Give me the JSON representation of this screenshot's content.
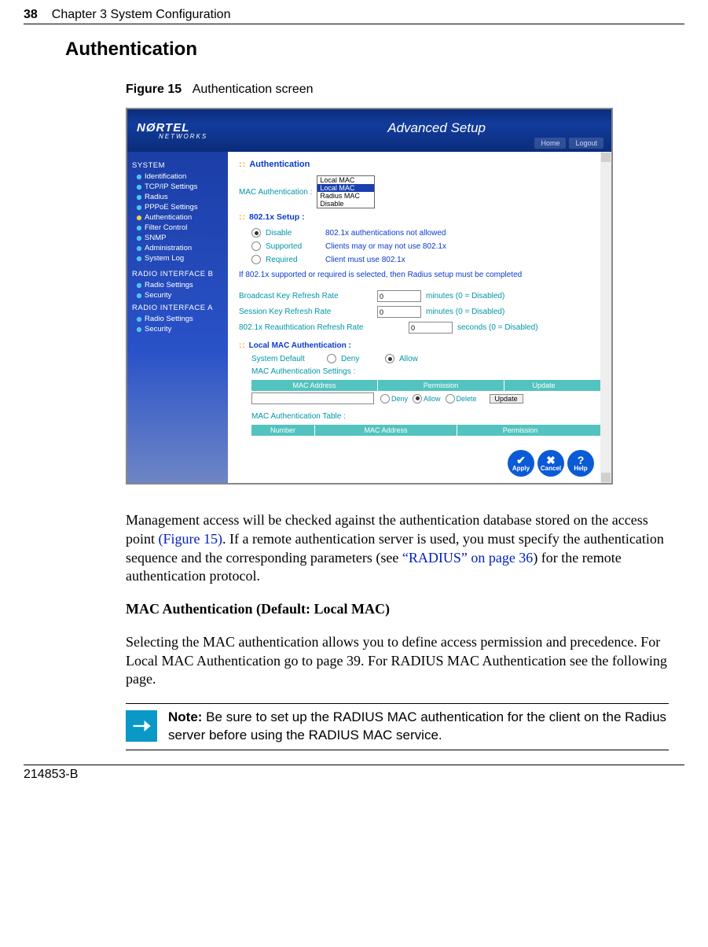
{
  "page": {
    "number": "38",
    "chapter": "Chapter 3  System Configuration",
    "footer_id": "214853-B"
  },
  "headings": {
    "h1": "Authentication",
    "figure_label": "Figure 15",
    "figure_title": "Authentication screen",
    "sub1": "MAC Authentication (Default: Local MAC)"
  },
  "paragraphs": {
    "p1a": "Management access will be checked against the authentication database stored on the access point ",
    "p1_link1": "(Figure 15)",
    "p1b": ". If a remote authentication server is used, you must specify the authentication sequence and the corresponding parameters (see ",
    "p1_link2": "“RADIUS” on page 36",
    "p1c": ") for the remote authentication protocol.",
    "p2": "Selecting the MAC authentication allows you to define access permission and precedence. For Local MAC Authentication go to page 39. For RADIUS MAC Authentication see the following page."
  },
  "note": {
    "label": "Note: ",
    "text": "Be sure to set up the RADIUS MAC authentication for the client on the Radius server before using the RADIUS MAC service."
  },
  "screenshot": {
    "logo_top": "NØRTEL",
    "logo_sub": "NETWORKS",
    "banner_title": "Advanced Setup",
    "top_buttons": {
      "home": "Home",
      "logout": "Logout"
    },
    "sidebar": {
      "section1": "SYSTEM",
      "s1_items": [
        "Identification",
        "TCP/IP Settings",
        "Radius",
        "PPPoE Settings",
        "Authentication",
        "Filter Control",
        "SNMP",
        "Administration",
        "System Log"
      ],
      "section2": "RADIO INTERFACE B",
      "s2_items": [
        "Radio Settings",
        "Security"
      ],
      "section3": "RADIO INTERFACE A",
      "s3_items": [
        "Radio Settings",
        "Security"
      ]
    },
    "content": {
      "title": "Authentication",
      "mac_auth_label": "MAC Authentication :",
      "mac_auth_options": [
        "Local MAC",
        "Local MAC",
        "Radius MAC",
        "Disable"
      ],
      "setup_label": "802.1x Setup :",
      "radio_disable": "Disable",
      "radio_disable_desc": "802.1x authentications not allowed",
      "radio_supported": "Supported",
      "radio_supported_desc": "Clients may or may not use 802.1x",
      "radio_required": "Required",
      "radio_required_desc": "Client must use 802.1x",
      "note_line": "If 802.1x supported or required is selected, then Radius setup must be completed",
      "bkey_label": "Broadcast Key Refresh Rate",
      "bkey_val": "0",
      "bkey_unit": "minutes  (0 = Disabled)",
      "skey_label": "Session Key Refresh Rate",
      "skey_val": "0",
      "skey_unit": "minutes  (0 = Disabled)",
      "reauth_label": "802.1x Reauthtication Refresh Rate",
      "reauth_val": "0",
      "reauth_unit": "seconds  (0 = Disabled)",
      "local_mac_title": "Local MAC Authentication :",
      "sys_default": "System Default",
      "deny": "Deny",
      "allow": "Allow",
      "mac_settings_label": "MAC Authentication Settings :",
      "col_mac": "MAC Address",
      "col_perm": "Permission",
      "col_upd": "Update",
      "opt_deny": "Deny",
      "opt_allow": "Allow",
      "opt_delete": "Delete",
      "update_btn": "Update",
      "mac_table_label": "MAC Authentication Table :",
      "col_num": "Number",
      "buttons": {
        "apply": "Apply",
        "cancel": "Cancel",
        "help": "Help"
      }
    }
  }
}
